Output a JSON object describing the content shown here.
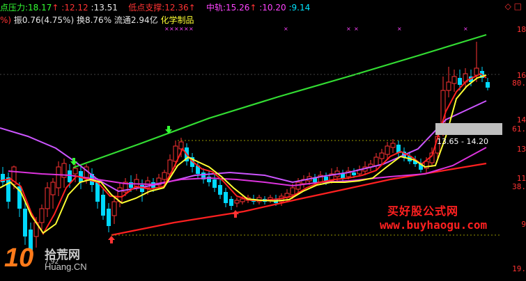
{
  "header": {
    "pressure_label": "点压力:",
    "pressure_value": "18.17",
    "pressure_arrow": "↑",
    "pressure_low": ":12.12",
    "pressure_mid": ":13.51",
    "support_label": "低点支撑:",
    "support_value": "12.36",
    "support_arrow": "↑",
    "middle_label": "中轨:",
    "middle_value": "15.26",
    "middle_arrow": "↑",
    "middle_low": ":10.20",
    "middle_mid": ":9.14",
    "corner_icon": "◇ □"
  },
  "info": {
    "paren": "%)",
    "amplitude": "振0.76(4.75%)",
    "turnover": "换8.76%",
    "float": "流通2.94亿",
    "industry": "化学制品"
  },
  "axis_labels": [
    "18",
    "16",
    "80.",
    "14",
    "61.",
    "13",
    "11",
    "38.",
    "9",
    "19."
  ],
  "range_label": "13.65 - 14.20",
  "watermark": {
    "text": "买好股公式网",
    "url": "www.buyhaogu.com"
  },
  "logo": {
    "big": "10",
    "cn": "拾荒网",
    "en": "Huang.CN",
    "min_label": "7.92"
  },
  "colors": {
    "upper_band": "#33dd33",
    "lower_band": "#ff2020",
    "middle_band": "#cc55ff",
    "ma_fast": "#ff2020",
    "ma_slow": "#ffff33",
    "ma_long": "#dd33dd",
    "candle_up": "#ff3333",
    "candle_down": "#00d9ff"
  }
}
